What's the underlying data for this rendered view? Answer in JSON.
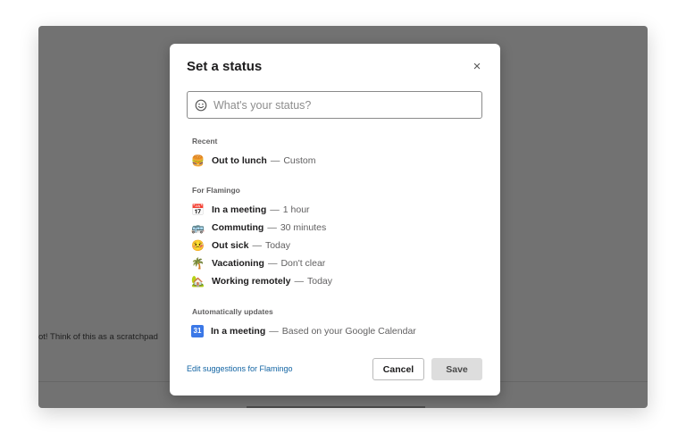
{
  "background": {
    "scratchpad_text": "ot! Think of this as a scratchpad"
  },
  "modal": {
    "title": "Set a status",
    "close_icon": "×",
    "input": {
      "placeholder": "What's your status?",
      "value": ""
    },
    "sections": [
      {
        "label": "Recent",
        "items": [
          {
            "emoji": "🍔",
            "name": "Out to lunch",
            "detail": "Custom"
          }
        ]
      },
      {
        "label": "For Flamingo",
        "items": [
          {
            "emoji": "📅",
            "name": "In a meeting",
            "detail": "1 hour"
          },
          {
            "emoji": "🚌",
            "name": "Commuting",
            "detail": "30 minutes"
          },
          {
            "emoji": "🤒",
            "name": "Out sick",
            "detail": "Today"
          },
          {
            "emoji": "🌴",
            "name": "Vacationing",
            "detail": "Don't clear"
          },
          {
            "emoji": "🏡",
            "name": "Working remotely",
            "detail": "Today"
          }
        ]
      },
      {
        "label": "Automatically updates",
        "items": [
          {
            "emoji": "31",
            "name": "In a meeting",
            "detail": "Based on your Google Calendar"
          }
        ]
      }
    ],
    "dash": "—",
    "edit_link": "Edit suggestions for Flamingo",
    "cancel_label": "Cancel",
    "save_label": "Save"
  },
  "colors": {
    "overlay": "#727272",
    "link": "#1264a3",
    "save_disabled": "#dddddd"
  },
  "icons": {
    "input": "smiley-icon",
    "close": "close-icon"
  }
}
